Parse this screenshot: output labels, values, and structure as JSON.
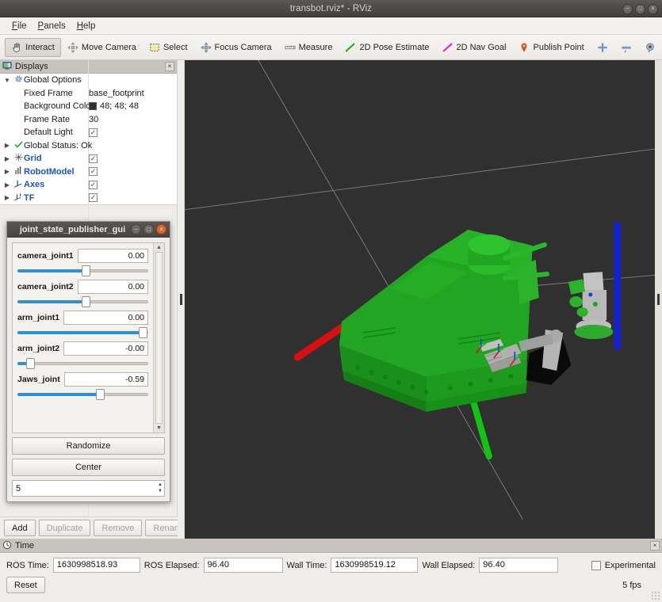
{
  "window": {
    "title": "transbot.rviz* - RViz",
    "buttons": [
      {
        "name": "minimize",
        "glyph": "–"
      },
      {
        "name": "maximize",
        "glyph": "□"
      },
      {
        "name": "close",
        "glyph": "×"
      }
    ]
  },
  "menubar": {
    "items": [
      {
        "label": "File",
        "mnemonic": "F"
      },
      {
        "label": "Panels",
        "mnemonic": "P"
      },
      {
        "label": "Help",
        "mnemonic": "H"
      }
    ]
  },
  "toolbar": {
    "tools": [
      {
        "label": "Interact",
        "icon": "hand-icon",
        "active": true
      },
      {
        "label": "Move Camera",
        "icon": "move-camera-icon",
        "active": false
      },
      {
        "label": "Select",
        "icon": "select-rect-icon",
        "active": false
      },
      {
        "label": "Focus Camera",
        "icon": "focus-camera-icon",
        "active": false
      },
      {
        "label": "Measure",
        "icon": "measure-icon",
        "active": false
      },
      {
        "label": "2D Pose Estimate",
        "icon": "pose-estimate-icon",
        "active": false
      },
      {
        "label": "2D Nav Goal",
        "icon": "nav-goal-icon",
        "active": false
      },
      {
        "label": "Publish Point",
        "icon": "publish-point-icon",
        "active": false
      }
    ],
    "extra": [
      {
        "name": "add-tool-button",
        "icon": "plus-icon"
      },
      {
        "name": "remove-tool-button",
        "icon": "minus-icon"
      },
      {
        "name": "tool-properties-button",
        "icon": "target-icon"
      }
    ]
  },
  "displays": {
    "panel_title": "Displays",
    "panel_icon": "displays-icon",
    "close_label": "×",
    "rows": [
      {
        "expander": "▼",
        "icon": "gear-icon",
        "label": "Global Options",
        "value": "",
        "type": "group",
        "blue": false
      },
      {
        "expander": "",
        "icon": "",
        "label": "Fixed Frame",
        "value": "base_footprint",
        "type": "text",
        "blue": false
      },
      {
        "expander": "",
        "icon": "",
        "label": "Background Color",
        "value": "48; 48; 48",
        "type": "color",
        "blue": false
      },
      {
        "expander": "",
        "icon": "",
        "label": "Frame Rate",
        "value": "30",
        "type": "text",
        "blue": false
      },
      {
        "expander": "",
        "icon": "",
        "label": "Default Light",
        "value": "",
        "type": "check",
        "blue": false
      },
      {
        "expander": "▶",
        "icon": "check-icon",
        "label": "Global Status: Ok",
        "value": "",
        "type": "status",
        "blue": false
      },
      {
        "expander": "▶",
        "icon": "grid-icon",
        "label": "Grid",
        "value": "",
        "type": "check",
        "blue": true
      },
      {
        "expander": "▶",
        "icon": "robot-icon",
        "label": "RobotModel",
        "value": "",
        "type": "check",
        "blue": true
      },
      {
        "expander": "▶",
        "icon": "axes-icon",
        "label": "Axes",
        "value": "",
        "type": "check",
        "blue": true
      },
      {
        "expander": "▶",
        "icon": "tf-icon",
        "label": "TF",
        "value": "",
        "type": "check",
        "blue": true
      }
    ],
    "background_color_hex": "#303030",
    "buttons": [
      {
        "label": "Add",
        "enabled": true
      },
      {
        "label": "Duplicate",
        "enabled": false
      },
      {
        "label": "Remove",
        "enabled": false
      },
      {
        "label": "Rename",
        "enabled": false
      }
    ]
  },
  "joint_state_publisher": {
    "title": "joint_state_publisher_gui",
    "titlebar_buttons": [
      {
        "name": "minimize",
        "glyph": "–"
      },
      {
        "name": "maximize",
        "glyph": "□"
      },
      {
        "name": "close",
        "glyph": "×"
      }
    ],
    "joints": [
      {
        "name": "camera_joint1",
        "value": "0.00",
        "percent": 52
      },
      {
        "name": "camera_joint2",
        "value": "0.00",
        "percent": 52
      },
      {
        "name": "arm_joint1",
        "value": "0.00",
        "percent": 97
      },
      {
        "name": "arm_joint2",
        "value": "-0.00",
        "percent": 7
      },
      {
        "name": "Jaws_joint",
        "value": "-0.59",
        "percent": 63
      }
    ],
    "randomize_label": "Randomize",
    "center_label": "Center",
    "rate_value": "5",
    "scroll_up_glyph": "▲",
    "scroll_down_glyph": "▼"
  },
  "time_panel": {
    "panel_title": "Time",
    "panel_icon": "clock-icon",
    "close_label": "×",
    "fields": [
      {
        "label": "ROS Time:",
        "value": "1630998518.93",
        "width": "wide"
      },
      {
        "label": "ROS Elapsed:",
        "value": "96.40",
        "width": "narrow"
      },
      {
        "label": "Wall Time:",
        "value": "1630998519.12",
        "width": "wide"
      },
      {
        "label": "Wall Elapsed:",
        "value": "96.40",
        "width": "narrow"
      }
    ],
    "experimental_label": "Experimental",
    "experimental_checked": false,
    "reset_label": "Reset",
    "fps": "5 fps"
  },
  "viewport": {
    "background_hex": "#303030",
    "grid_line_color": "#8e8e8e",
    "robot_color": "#1aa51a",
    "axis_x_color": "#d81010",
    "axis_y_color": "#12c312",
    "axis_z_color": "#1420d8"
  }
}
